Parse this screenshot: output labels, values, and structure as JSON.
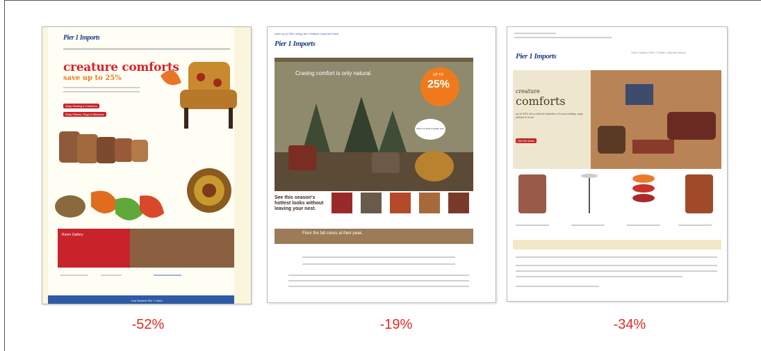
{
  "cards": [
    {
      "logo": "Pier 1 Imports",
      "headline": "creature comforts",
      "subheadline": "save up to 25%",
      "buttons": [
        "Shop Seating & Cushions",
        "Shop Pillows, Rugs & Windows"
      ],
      "gallery_title": "Room Gallery",
      "footer": "Your Nearest Pier 1 Store"
    },
    {
      "top_link": "Save up to 25% during the Creature Comforts Event",
      "logo": "Pier 1 Imports",
      "hero_text": "Craving comfort is only natural.",
      "badge_small": "UP TO",
      "badge_big": "25%",
      "speech": "Click on a chair to gather nuts",
      "side_heading": "See this season's hottest looks without leaving your nest.",
      "banner": "Floor the fall colors at their peak."
    },
    {
      "logo": "Pier 1 Imports",
      "nav": "Store Gallery | Pier 1 Studio | Special Values",
      "headline_small": "creature",
      "headline_big": "comforts",
      "offer": "up to 25% off a colorful collection of cozy seating, rugs, pillows & more.",
      "cta": "Get the ideas"
    }
  ],
  "percentages": [
    "-52%",
    "-19%",
    "-34%"
  ],
  "colors": {
    "percent": "#e02b20",
    "brand": "#1f3f8f",
    "accent_red": "#c7262c"
  }
}
